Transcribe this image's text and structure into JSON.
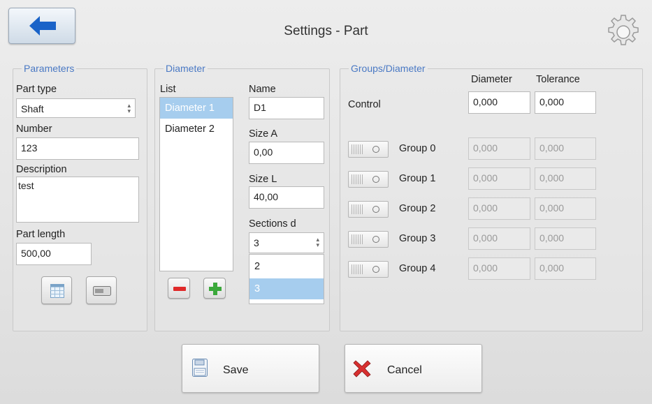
{
  "header": {
    "title": "Settings - Part"
  },
  "parameters": {
    "legend": "Parameters",
    "part_type_label": "Part type",
    "part_type_value": "Shaft",
    "number_label": "Number",
    "number_value": "123",
    "description_label": "Description",
    "description_value": "test",
    "part_length_label": "Part length",
    "part_length_value": "500,00"
  },
  "diameter": {
    "legend": "Diameter",
    "list_label": "List",
    "list_items": [
      "Diameter 1",
      "Diameter 2"
    ],
    "selected_item": "Diameter 1",
    "name_label": "Name",
    "name_value": "D1",
    "size_a_label": "Size A",
    "size_a_value": "0,00",
    "size_l_label": "Size L",
    "size_l_value": "40,00",
    "sections_label": "Sections d",
    "sections_value": "3",
    "sections_options": [
      "2",
      "3"
    ]
  },
  "groups": {
    "legend": "Groups/Diameter",
    "diameter_header": "Diameter",
    "tolerance_header": "Tolerance",
    "control_label": "Control",
    "control_diameter": "0,000",
    "control_tolerance": "0,000",
    "rows": [
      {
        "label": "Group 0",
        "diameter": "0,000",
        "tolerance": "0,000"
      },
      {
        "label": "Group 1",
        "diameter": "0,000",
        "tolerance": "0,000"
      },
      {
        "label": "Group 2",
        "diameter": "0,000",
        "tolerance": "0,000"
      },
      {
        "label": "Group 3",
        "diameter": "0,000",
        "tolerance": "0,000"
      },
      {
        "label": "Group 4",
        "diameter": "0,000",
        "tolerance": "0,000"
      }
    ]
  },
  "footer": {
    "save_label": "Save",
    "cancel_label": "Cancel"
  },
  "colors": {
    "accent": "#4a79c4",
    "back_arrow": "#1a63c8",
    "selection": "#a6cdee"
  },
  "icons": [
    "back-arrow-icon",
    "gear-icon",
    "table-icon",
    "ruler-icon",
    "minus-icon",
    "plus-icon",
    "floppy-disk-icon",
    "cancel-x-icon"
  ]
}
